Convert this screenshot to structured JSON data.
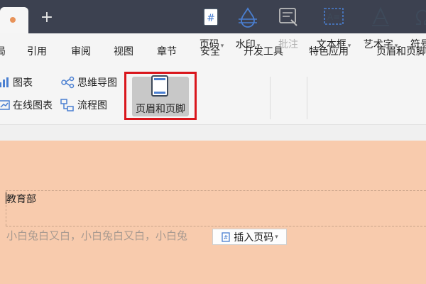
{
  "window": {
    "new_tab": "+"
  },
  "menu": [
    "局",
    "引用",
    "审阅",
    "视图",
    "章节",
    "安全",
    "开发工具",
    "特色应用",
    "页眉和页脚"
  ],
  "ribbon": {
    "chart": "图表",
    "online_chart": "在线图表",
    "mind_map": "思维导图",
    "flowchart": "流程图",
    "header_footer": "页眉和页脚",
    "page_number": "页码",
    "watermark": "水印",
    "comment": "批注",
    "text_box": "文本框",
    "word_art": "艺术字",
    "symbol": "符号"
  },
  "document": {
    "header_text": "教育部",
    "footer_text": "小白兔白又白，小白兔白又白，小白兔",
    "insert_page_number": "插入页码"
  },
  "colors": {
    "highlight": "#d9161c",
    "page": "#f8cbad",
    "titlebar": "#3c4150"
  },
  "icons": [
    "chart-icon",
    "online-chart-icon",
    "mind-map-icon",
    "flowchart-icon",
    "header-footer-icon",
    "page-number-icon",
    "watermark-icon",
    "comment-icon",
    "text-box-icon",
    "word-art-icon",
    "symbol-icon",
    "insert-page-number-icon"
  ]
}
